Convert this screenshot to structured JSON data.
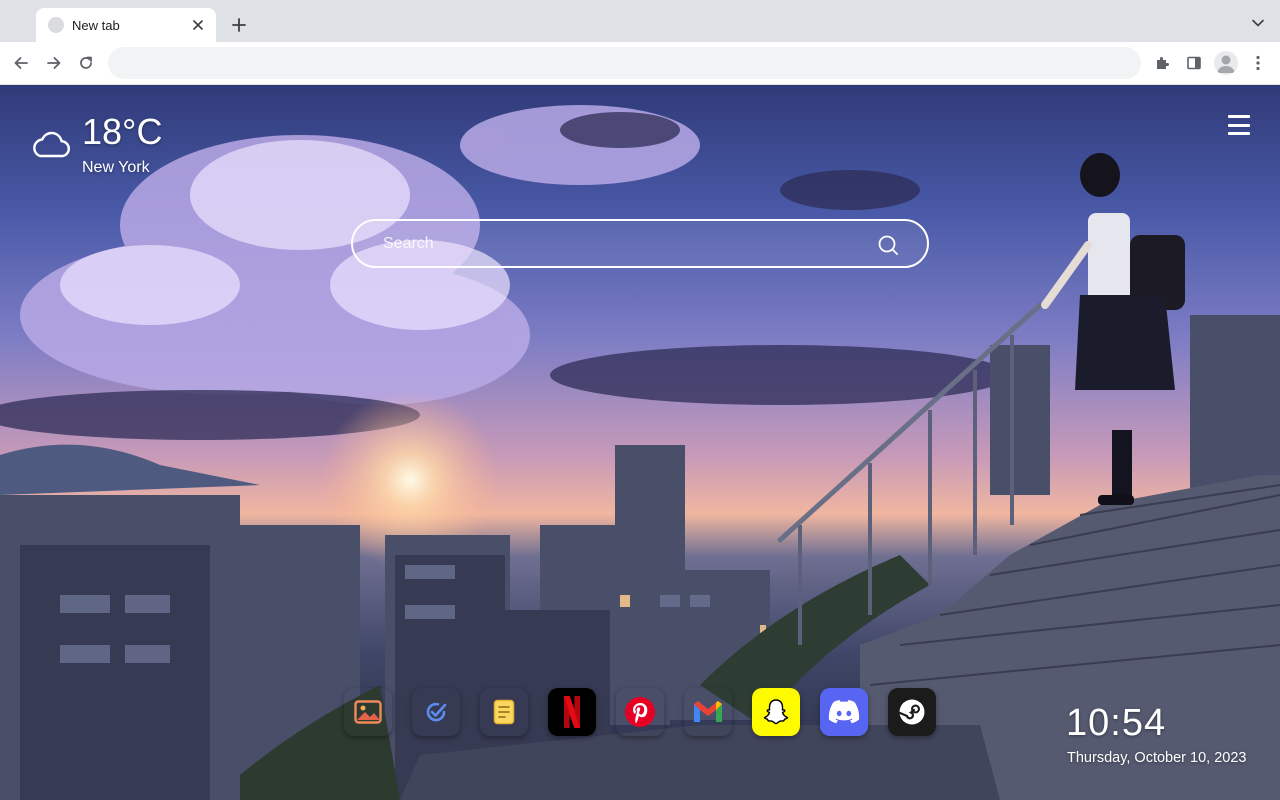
{
  "tab": {
    "title": "New tab"
  },
  "omnibox": {
    "value": ""
  },
  "weather": {
    "temperature": "18°C",
    "city": "New York",
    "icon": "cloud-icon"
  },
  "search": {
    "placeholder": "Search"
  },
  "dock": [
    {
      "name": "photos-shortcut",
      "icon": "photo-icon",
      "bg": "#ffffff"
    },
    {
      "name": "tasks-shortcut",
      "icon": "check-circle-icon",
      "bg": "#ffffff"
    },
    {
      "name": "notes-shortcut",
      "icon": "note-icon",
      "bg": "#ffffff"
    },
    {
      "name": "netflix-shortcut",
      "icon": "netflix-icon",
      "bg": "#000000"
    },
    {
      "name": "pinterest-shortcut",
      "icon": "pinterest-icon",
      "bg": "#ffffff"
    },
    {
      "name": "gmail-shortcut",
      "icon": "gmail-icon",
      "bg": "#ffffff"
    },
    {
      "name": "snapchat-shortcut",
      "icon": "snapchat-icon",
      "bg": "#fffc00"
    },
    {
      "name": "discord-shortcut",
      "icon": "discord-icon",
      "bg": "#5865f2"
    },
    {
      "name": "steam-shortcut",
      "icon": "steam-icon",
      "bg": "#1b1b1b"
    }
  ],
  "clock": {
    "time": "10:54",
    "date": "Thursday, October 10, 2023"
  },
  "colors": {
    "tabstrip": "#dee1e6",
    "toolbar": "#ffffff",
    "omnibox": "#f1f3f4"
  }
}
